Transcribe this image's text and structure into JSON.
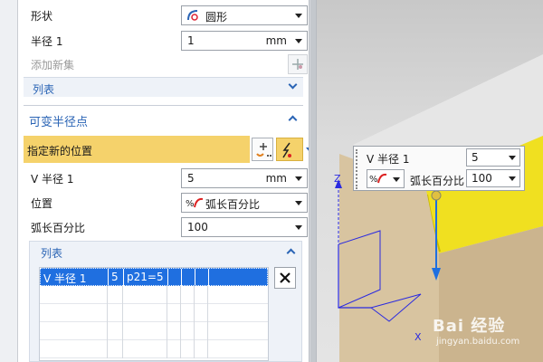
{
  "panel": {
    "shape": {
      "label": "形状",
      "value": "圆形"
    },
    "radius1": {
      "label": "半径 1",
      "value": "1",
      "unit": "mm"
    },
    "add_new_set": {
      "label": "添加新集"
    },
    "list1": {
      "label": "列表"
    },
    "variable_radius": {
      "title": "可变半径点",
      "specify_location": {
        "label": "指定新的位置"
      },
      "v_radius1": {
        "label": "V 半径 1",
        "value": "5",
        "unit": "mm"
      },
      "position": {
        "label": "位置",
        "value": "弧长百分比"
      },
      "arc_percent": {
        "label": "弧长百分比",
        "value": "100"
      },
      "list2": {
        "label": "列表",
        "rows": [
          {
            "cells": [
              "V 半径 1",
              "5",
              "p21=5",
              "",
              "",
              ""
            ],
            "selected": true
          },
          {
            "cells": [
              "",
              "",
              "",
              "",
              "",
              ""
            ],
            "selected": false
          },
          {
            "cells": [
              "",
              "",
              "",
              "",
              "",
              ""
            ],
            "selected": false
          },
          {
            "cells": [
              "",
              "",
              "",
              "",
              "",
              ""
            ],
            "selected": false
          },
          {
            "cells": [
              "",
              "",
              "",
              "",
              "",
              ""
            ],
            "selected": false
          }
        ],
        "delete_icon": "close-icon"
      }
    }
  },
  "viewport": {
    "popup": {
      "v_radius_label": "V 半径 1",
      "v_radius_value": "5",
      "arc_label": "弧长百分比",
      "arc_value": "100"
    },
    "axis_z": "Z",
    "axis_x": "X",
    "watermark_main": "Bai 经验",
    "watermark_sub": "jingyan.baidu.com"
  },
  "colors": {
    "highlight": "#f5d26b",
    "selected_row": "#1f6fe0",
    "section_text": "#2a64b5",
    "solid_yellow": "#f0e020",
    "solid_tan": "#d8c4a0"
  }
}
